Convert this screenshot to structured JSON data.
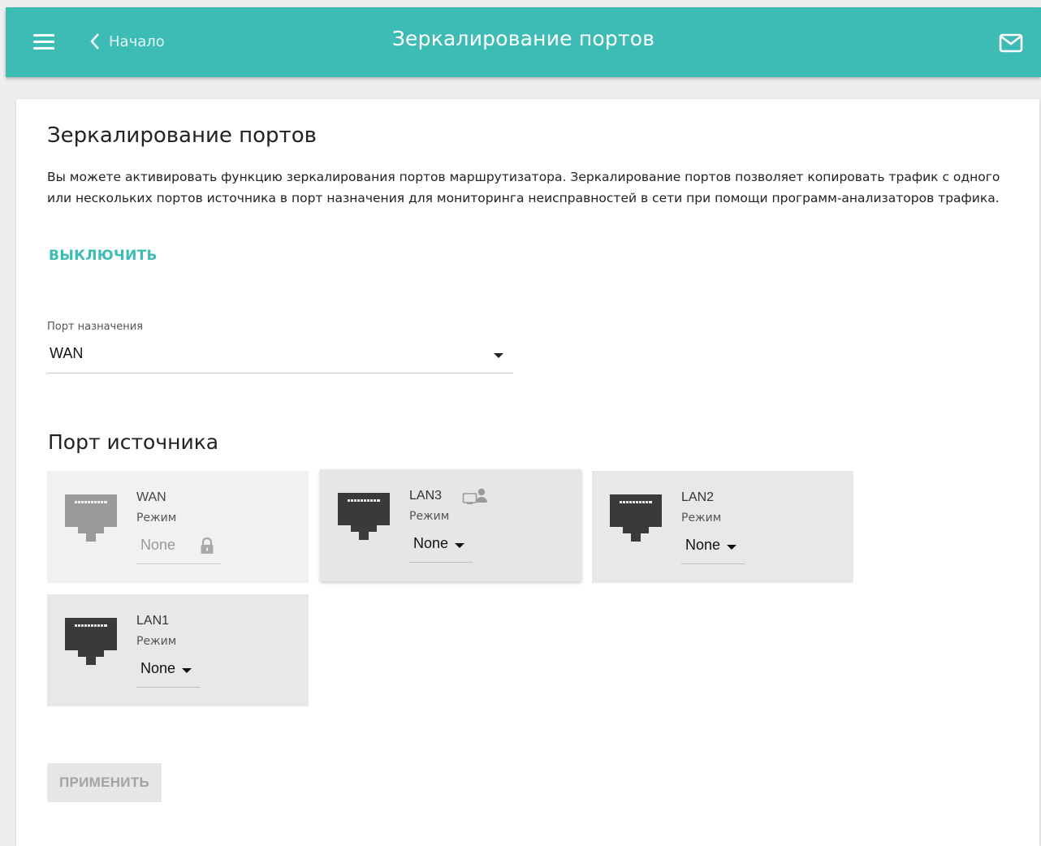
{
  "header": {
    "back_label": "Начало",
    "title": "Зеркалирование портов",
    "accent_color": "#3dbcb6",
    "menu_icon": "hamburger-icon",
    "back_icon": "chevron-left-icon",
    "mail_icon": "envelope-icon"
  },
  "page": {
    "heading": "Зеркалирование портов",
    "description": "Вы можете активировать функцию зеркалирования портов маршрутизатора. Зеркалирование портов позволяет копировать трафик с одного или нескольких портов источника в порт назначения для мониторинга неисправностей в сети при помощи программ-анализаторов трафика.",
    "disable_label": "ВЫКЛЮЧИТЬ"
  },
  "destination": {
    "label": "Порт назначения",
    "value": "WAN"
  },
  "source": {
    "heading": "Порт источника",
    "ports": [
      {
        "name": "WAN",
        "mode_label": "Режим",
        "mode_value": "None",
        "locked": true,
        "lock_icon": "lock-icon"
      },
      {
        "name": "LAN3",
        "mode_label": "Режим",
        "mode_value": "None",
        "connected_icon": "computer-user-icon"
      },
      {
        "name": "LAN2",
        "mode_label": "Режим",
        "mode_value": "None"
      },
      {
        "name": "LAN1",
        "mode_label": "Режим",
        "mode_value": "None"
      }
    ]
  },
  "actions": {
    "apply_label": "ПРИМЕНИТЬ"
  }
}
